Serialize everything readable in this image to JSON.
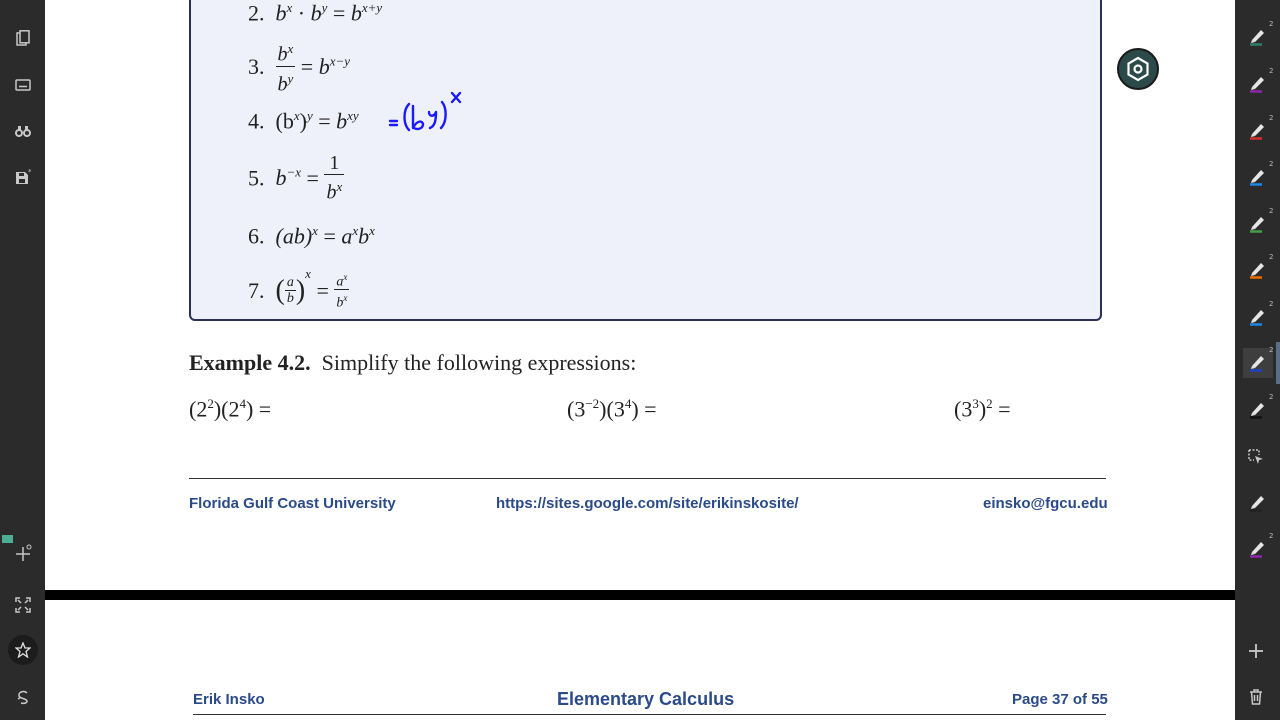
{
  "rules": {
    "r2": {
      "num": "2.",
      "b1": "b",
      "x": "x",
      "dot": "·",
      "b2": "b",
      "y": "y",
      "eq": "=",
      "b3": "b",
      "exp": "x+y"
    },
    "r3": {
      "num": "3.",
      "top": "b",
      "topexp": "x",
      "bot": "b",
      "botexp": "y",
      "eq": "=",
      "b": "b",
      "exp": "x−y"
    },
    "r4": {
      "num": "4.",
      "lhs_open": "(b",
      "x": "x",
      "close": ")",
      "y": "y",
      "eq": "=",
      "b": "b",
      "exp": "xy"
    },
    "r5": {
      "num": "5.",
      "b": "b",
      "exp": "−x",
      "eq": "=",
      "top": "1",
      "bot": "b",
      "botexp": "x"
    },
    "r6": {
      "num": "6.",
      "lhs": "(ab)",
      "x1": "x",
      "eq": "=",
      "a": "a",
      "x2": "x",
      "b": "b",
      "x3": "x"
    },
    "r7": {
      "num": "7.",
      "a": "a",
      "b": "b",
      "x": "x",
      "eq": "=",
      "ra": "a",
      "rax": "x",
      "rb": "b",
      "rbx": "x"
    }
  },
  "handwriting_note": "= (b^y)^x",
  "example": {
    "label": "Example 4.2.",
    "text": "Simplify the following expressions:",
    "expr1": {
      "a": "(2",
      "e1": "2",
      "b": ")(2",
      "e2": "4",
      "c": ") ="
    },
    "expr2": {
      "a": "(3",
      "e1": "−2",
      "b": ")(3",
      "e2": "4",
      "c": ") ="
    },
    "expr3": {
      "a": "(3",
      "e1": "3",
      "b": ")",
      "e2": "2",
      "c": " ="
    }
  },
  "footer": {
    "university": "Florida Gulf Coast University",
    "url": "https://sites.google.com/site/erikinskosite/",
    "email": "einsko@fgcu.edu"
  },
  "page2": {
    "author": "Erik Insko",
    "title": "Elementary Calculus",
    "page_indicator": "Page 37 of 55"
  },
  "left_toolbar": {
    "icons": [
      "pages-icon",
      "keyboard-icon",
      "binoculars-icon",
      "save-icon",
      "add-page-icon",
      "fit-screen-icon",
      "star-icon",
      "lasso-icon"
    ]
  },
  "right_toolbar": {
    "pen_colors": [
      "#2e7d6b",
      "#8e24aa",
      "#d32f2f",
      "#1e88e5",
      "#43a047",
      "#ef6c00",
      "#1e88e5",
      "#1e40c8",
      "#111111",
      "#222222",
      "#8e24aa"
    ],
    "pen_superscript": "2"
  },
  "colors": {
    "box_border": "#2b2f55",
    "box_fill": "#eef0fa",
    "footer_blue": "#2a4a88",
    "ink_blue": "#1a1aff"
  }
}
